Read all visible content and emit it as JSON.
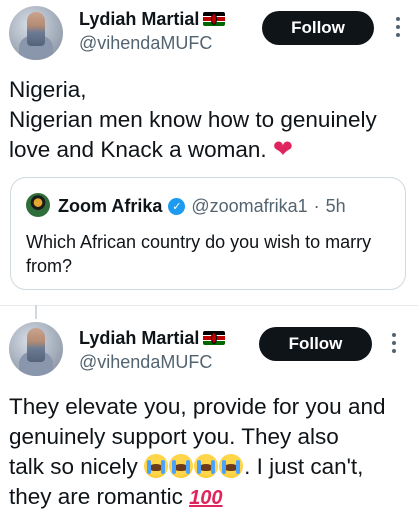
{
  "tweets": [
    {
      "author": {
        "name": "Lydiah Martial",
        "handle": "@vihendaMUFC"
      },
      "follow_label": "Follow",
      "text_lines": [
        "Nigeria,",
        "Nigerian men know how to genuinely",
        "love and Knack a woman."
      ],
      "heart_emoji": "❤",
      "quoted": {
        "name": "Zoom Afrika",
        "handle": "@zoomafrika1",
        "separator": "·",
        "time": "5h",
        "text": "Which African country do you wish to marry from?"
      }
    },
    {
      "author": {
        "name": "Lydiah Martial",
        "handle": "@vihendaMUFC"
      },
      "follow_label": "Follow",
      "text_lines": [
        "They elevate you, provide for you and",
        "genuinely support you. They also",
        "talk so nicely",
        ". I just can't,",
        "they are romantic"
      ],
      "hundred_emoji": "100"
    }
  ],
  "icons": {
    "flag": "kenya-flag-icon",
    "more": "more-dots-icon",
    "verified": "verified-badge-icon"
  },
  "colors": {
    "follow_bg": "#0f1419",
    "handle": "#536471",
    "verified": "#1d9bf0",
    "heart": "#e0245e"
  }
}
